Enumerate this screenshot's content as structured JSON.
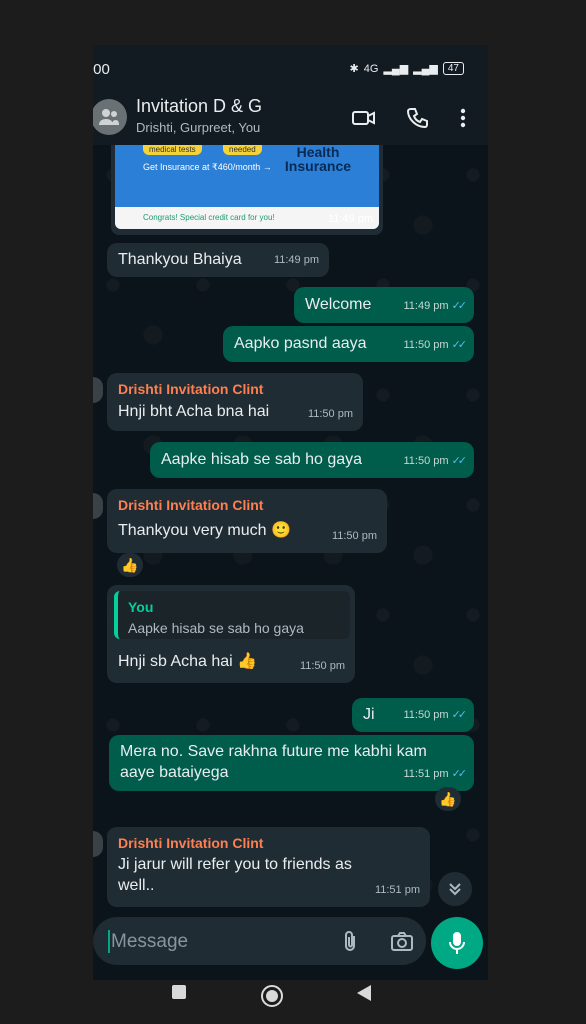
{
  "status": {
    "time": ":00",
    "network": "4G",
    "battery": "47"
  },
  "header": {
    "title": "Invitation D & G",
    "subtitle": "Drishti, Gurpreet, You",
    "icons": [
      "group-avatar-icon",
      "video-call-icon",
      "voice-call-icon",
      "more-options-icon"
    ]
  },
  "chat": {
    "image_message": {
      "banner_tags": [
        "medical tests",
        "needed"
      ],
      "banner_cta": "Get Insurance at ₹460/month →",
      "banner_headline": "Health Insurance",
      "banner_promo": "Congrats! Special credit card for you!",
      "time": "11:49 pm"
    },
    "messages": [
      {
        "text": "Thankyou Bhaiya",
        "time": "11:49 pm"
      },
      {
        "text": "Welcome",
        "time": "11:49 pm"
      },
      {
        "text": "Aapko pasnd aaya",
        "time": "11:50 pm"
      },
      {
        "sender": "Drishti Invitation Clint",
        "text": "Hnji bht Acha bna hai",
        "time": "11:50 pm"
      },
      {
        "text": "Aapke hisab se sab ho gaya",
        "time": "11:50 pm"
      },
      {
        "sender": "Drishti Invitation Clint",
        "text": "Thankyou very much 🙂",
        "time": "11:50 pm",
        "reaction": "👍"
      },
      {
        "quote_author": "You",
        "quote_text": "Aapke hisab se sab ho gaya",
        "text": "Hnji sb Acha hai 👍",
        "time": "11:50 pm"
      },
      {
        "text": "Ji",
        "time": "11:50 pm"
      },
      {
        "text": "Mera no. Save rakhna future me kabhi kam aaye bataiyega",
        "time": "11:51 pm",
        "reaction": "👍"
      },
      {
        "sender": "Drishti Invitation Clint",
        "text": "Ji jarur will refer you to friends as well..",
        "time": "11:51 pm"
      }
    ],
    "read_ticks": "✓✓"
  },
  "composer": {
    "placeholder": "Message"
  },
  "colors": {
    "incoming": "#202c33",
    "outgoing": "#005c4b",
    "accent": "#00a884",
    "sender": "#ff7f50",
    "read_tick": "#53bdeb"
  }
}
